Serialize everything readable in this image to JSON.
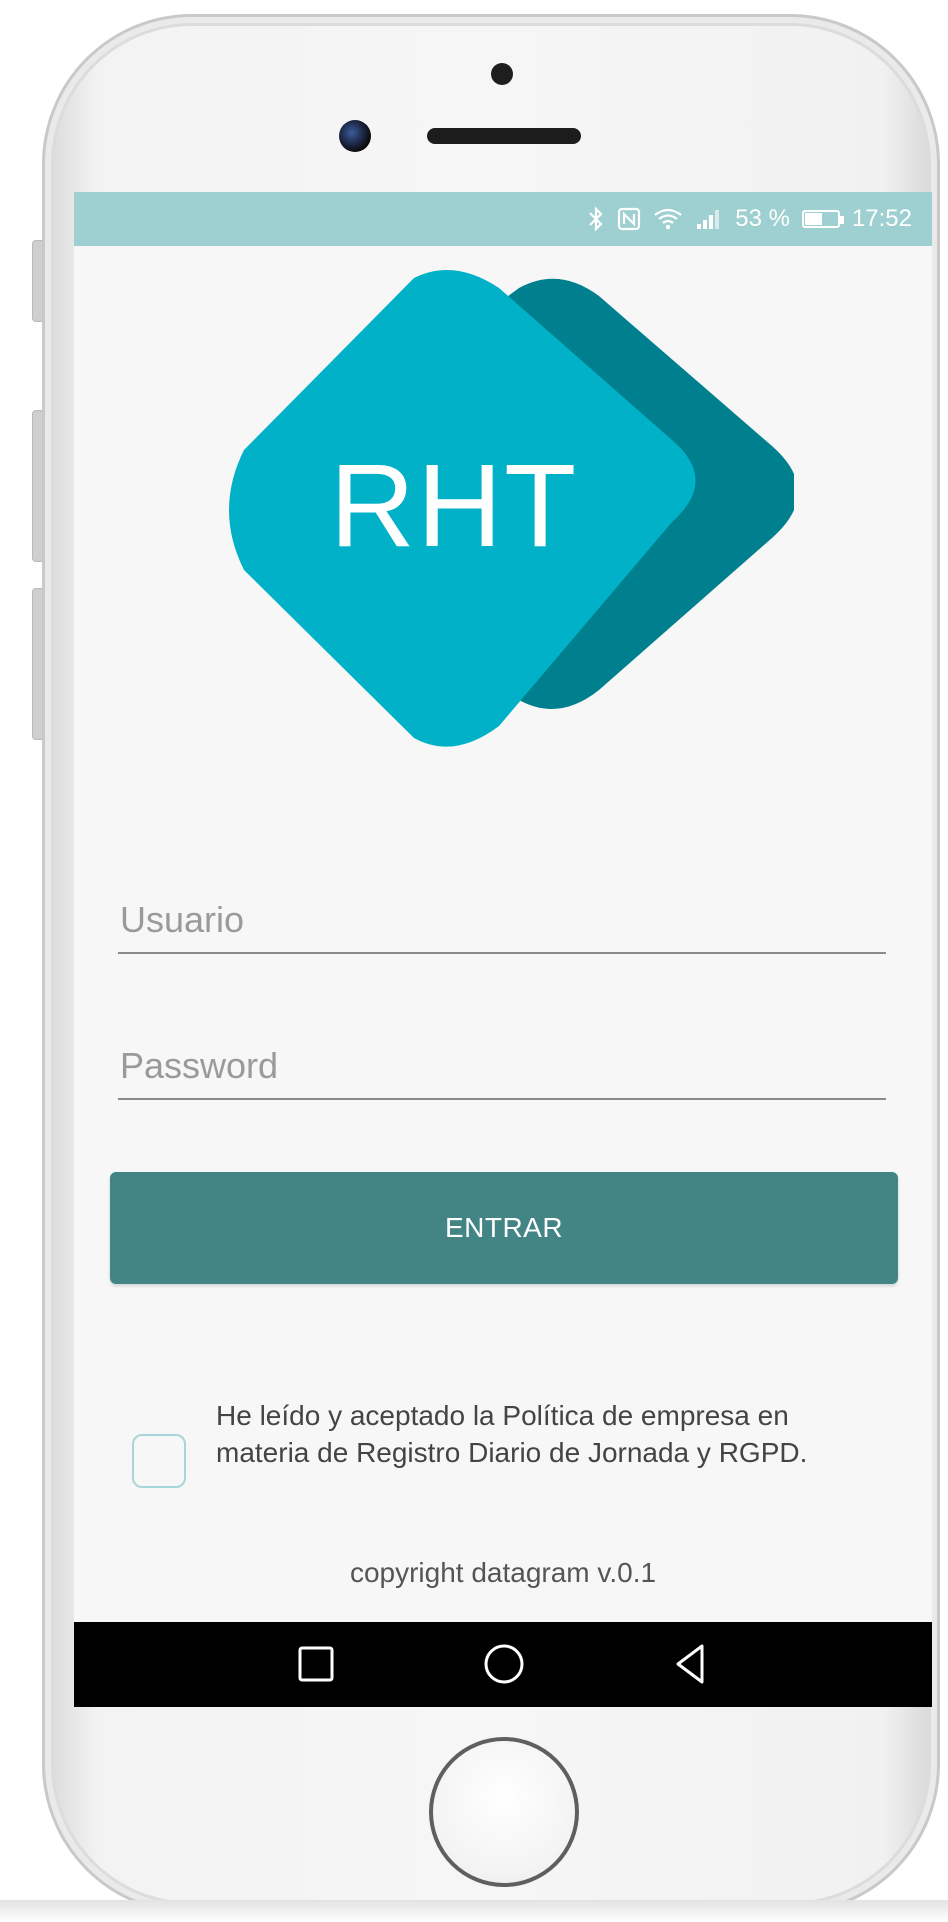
{
  "status_bar": {
    "battery_percent": "53 %",
    "time": "17:52",
    "battery_level": 0.53,
    "icons": [
      "bluetooth-icon",
      "nfc-icon",
      "wifi-icon",
      "signal-icon",
      "battery-icon"
    ]
  },
  "logo": {
    "text": "RHT",
    "colors": {
      "front": "#00b1c7",
      "back": "#00808f"
    }
  },
  "login_form": {
    "username_placeholder": "Usuario",
    "password_placeholder": "Password",
    "submit_label": "ENTRAR"
  },
  "consent": {
    "label": "He leído y aceptado la Política de empresa en materia de Registro Diario de Jornada y RGPD.",
    "checked": false
  },
  "footer": {
    "copyright": "copyright datagram v.0.1"
  },
  "nav_bar": {
    "buttons": [
      "recents-icon",
      "home-icon",
      "back-icon"
    ]
  },
  "colors": {
    "status_bar": "#9ed0d1",
    "button": "#438585",
    "checkbox_border": "#a8d6d8",
    "screen_bg": "#f7f7f7"
  }
}
